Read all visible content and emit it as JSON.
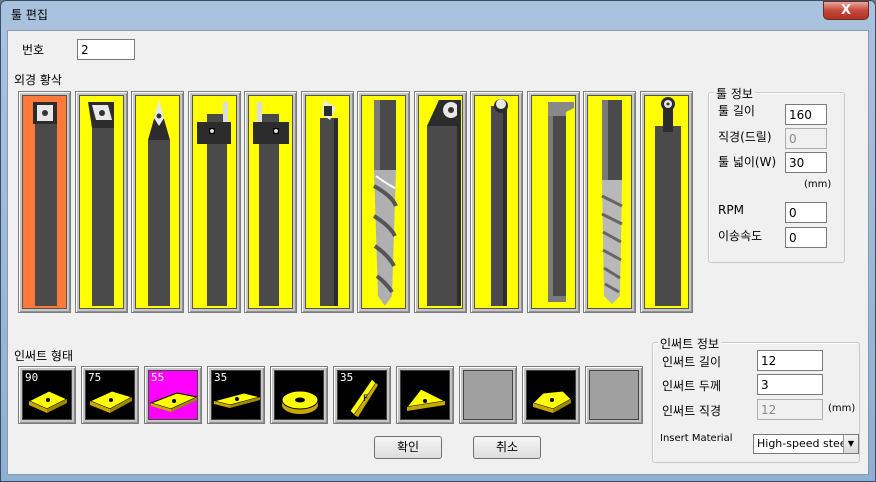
{
  "window": {
    "title": "툴 편집",
    "close_label": "X"
  },
  "number": {
    "label": "번호",
    "value": "2"
  },
  "tools_section": {
    "label": "외경 황삭"
  },
  "tools": [
    {
      "name": "tool-turning-holder-square-insert",
      "selected": true
    },
    {
      "name": "tool-turning-holder-rhombic-insert",
      "selected": false
    },
    {
      "name": "tool-turning-holder-diamond-insert",
      "selected": false
    },
    {
      "name": "tool-grooving-holder-left",
      "selected": false
    },
    {
      "name": "tool-grooving-holder-right",
      "selected": false
    },
    {
      "name": "tool-boring-bar",
      "selected": false
    },
    {
      "name": "tool-twist-drill",
      "selected": false
    },
    {
      "name": "tool-face-milling-holder",
      "selected": false
    },
    {
      "name": "tool-boring-bar-round-insert",
      "selected": false
    },
    {
      "name": "tool-threading-holder",
      "selected": false
    },
    {
      "name": "tool-tap",
      "selected": false
    },
    {
      "name": "tool-round-insert-holder",
      "selected": false
    }
  ],
  "tool_info": {
    "title": "툴 정보",
    "length_label": "툴 길이",
    "length_value": "160",
    "diameter_label": "직경(드릴)",
    "diameter_value": "0",
    "width_label": "툴 넓이(W)",
    "width_value": "30",
    "unit": "(mm)",
    "rpm_label": "RPM",
    "rpm_value": "0",
    "feed_label": "이송속도",
    "feed_value": "0"
  },
  "insert_section": {
    "label": "인써트 형태"
  },
  "inserts": [
    {
      "name": "insert-square-90",
      "angle": "90",
      "selected": false
    },
    {
      "name": "insert-rhombic-75",
      "angle": "75",
      "selected": false
    },
    {
      "name": "insert-rhombic-55",
      "angle": "55",
      "selected": true
    },
    {
      "name": "insert-rhombic-35",
      "angle": "35",
      "selected": false
    },
    {
      "name": "insert-round",
      "angle": "",
      "selected": false
    },
    {
      "name": "insert-threading-35",
      "angle": "35",
      "selected": false
    },
    {
      "name": "insert-triangle",
      "angle": "",
      "selected": false
    },
    {
      "name": "insert-empty-1",
      "angle": "",
      "selected": false
    },
    {
      "name": "insert-trigon",
      "angle": "",
      "selected": false
    },
    {
      "name": "insert-empty-2",
      "angle": "",
      "selected": false
    }
  ],
  "insert_info": {
    "title": "인써트 정보",
    "length_label": "인써트 길이",
    "length_value": "12",
    "thickness_label": "인써트 두께",
    "thickness_value": "3",
    "diameter_label": "인써트 직경",
    "diameter_value": "12",
    "unit": "(mm)",
    "material_label": "Insert Material",
    "material_value": "High-speed steel"
  },
  "buttons": {
    "ok": "확인",
    "cancel": "취소"
  },
  "colors": {
    "tool_face": "#ffff00",
    "tool_selected": "#ff7a3a",
    "insert_face": "#000000",
    "insert_selected": "#ff00ff"
  }
}
